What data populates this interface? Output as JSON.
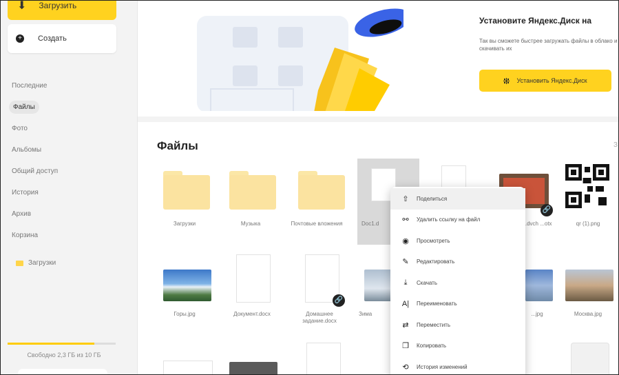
{
  "sidebar": {
    "upload_label": "Загрузить",
    "create_label": "Создать",
    "nav": [
      {
        "label": "Последние"
      },
      {
        "label": "Файлы",
        "active": true
      },
      {
        "label": "Фото"
      },
      {
        "label": "Альбомы"
      },
      {
        "label": "Общий доступ"
      },
      {
        "label": "История"
      },
      {
        "label": "Архив"
      },
      {
        "label": "Корзина"
      }
    ],
    "favorite_folder": "Загрузки",
    "space_used_fraction": 0.8,
    "space_text": "Свободно 2,3 ГБ из 10 ГБ"
  },
  "banner": {
    "title": "Установите Яндекс.Диск на",
    "text": "Так вы сможете быстрее загружать файлы в облако и скачивать их",
    "button_label": "Установить Яндекс.Диск"
  },
  "files": {
    "title": "Файлы",
    "side_mark": "З",
    "row1": [
      {
        "name": "Загрузки",
        "kind": "folder"
      },
      {
        "name": "Музыка",
        "kind": "folder"
      },
      {
        "name": "Почтовые вложения",
        "kind": "folder"
      },
      {
        "name": "Doc1.d",
        "kind": "doc"
      },
      {
        "name": "",
        "kind": "doc"
      },
      {
        "name": "...dvch ...otx",
        "kind": "image"
      },
      {
        "name": "qr (1).png",
        "kind": "qr"
      }
    ],
    "row2": [
      {
        "name": "Горы.jpg",
        "kind": "photo"
      },
      {
        "name": "Документ.docx",
        "kind": "doc"
      },
      {
        "name": "Домашнее задание.docx",
        "kind": "doc"
      },
      {
        "name": "Зима",
        "kind": "photo"
      },
      {
        "name": "...jpg",
        "kind": "photo"
      },
      {
        "name": "Москва.jpg",
        "kind": "photo"
      }
    ]
  },
  "context_menu": [
    {
      "label": "Поделиться",
      "icon": "share-icon"
    },
    {
      "label": "Удалить ссылку на файл",
      "icon": "link-icon"
    },
    {
      "label": "Просмотреть",
      "icon": "eye-icon"
    },
    {
      "label": "Редактировать",
      "icon": "pencil-icon"
    },
    {
      "label": "Скачать",
      "icon": "download-icon"
    },
    {
      "label": "Переименовать",
      "icon": "rename-icon"
    },
    {
      "label": "Переместить",
      "icon": "move-icon"
    },
    {
      "label": "Копировать",
      "icon": "copy-icon"
    },
    {
      "label": "История изменений",
      "icon": "history-icon"
    }
  ],
  "colors": {
    "accent": "#ffd21f",
    "folder": "#fbe3a0"
  }
}
